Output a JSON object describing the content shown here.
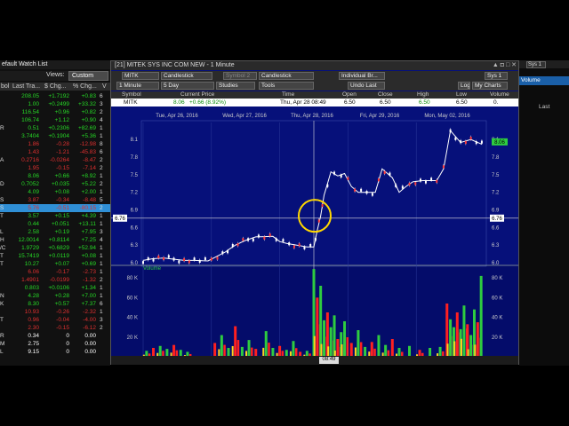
{
  "watchlist": {
    "title": "efault Watch List",
    "views_label": "Views:",
    "views_value": "Custom",
    "headers": [
      "bol",
      "Last Tra...",
      "$ Chg...",
      "% Chg...",
      "V"
    ],
    "rows": [
      {
        "sym": "",
        "last": "208.05",
        "chg": "+1.7192",
        "pct": "+0.83",
        "v": "6",
        "color": "#26d926"
      },
      {
        "sym": "",
        "last": "1.00",
        "chg": "+0.2499",
        "pct": "+33.32",
        "v": "3",
        "color": "#26d926"
      },
      {
        "sym": "",
        "last": "116.54",
        "chg": "+0.96",
        "pct": "+0.82",
        "v": "2",
        "color": "#26d926"
      },
      {
        "sym": "",
        "last": "106.74",
        "chg": "+1.12",
        "pct": "+0.90",
        "v": "4",
        "color": "#26d926"
      },
      {
        "sym": "R",
        "last": "0.51",
        "chg": "+0.2306",
        "pct": "+82.69",
        "v": "1",
        "color": "#26d926"
      },
      {
        "sym": "",
        "last": "3.7404",
        "chg": "+0.1904",
        "pct": "+5.36",
        "v": "1",
        "color": "#26d926"
      },
      {
        "sym": "",
        "last": "1.86",
        "chg": "-0.28",
        "pct": "-12.98",
        "v": "8",
        "color": "#e03030"
      },
      {
        "sym": "",
        "last": "1.43",
        "chg": "-1.21",
        "pct": "-45.83",
        "v": "6",
        "color": "#e03030"
      },
      {
        "sym": "A",
        "last": "0.2716",
        "chg": "-0.0264",
        "pct": "-8.47",
        "v": "2",
        "color": "#e03030"
      },
      {
        "sym": "",
        "last": "1.95",
        "chg": "-0.15",
        "pct": "-7.14",
        "v": "2",
        "color": "#e03030"
      },
      {
        "sym": "",
        "last": "8.06",
        "chg": "+0.66",
        "pct": "+8.92",
        "v": "1",
        "color": "#26d926"
      },
      {
        "sym": "D",
        "last": "0.7052",
        "chg": "+0.035",
        "pct": "+5.22",
        "v": "2",
        "color": "#26d926"
      },
      {
        "sym": "",
        "last": "4.09",
        "chg": "+0.08",
        "pct": "+2.00",
        "v": "1",
        "color": "#26d926"
      },
      {
        "sym": "S",
        "last": "3.87",
        "chg": "-0.34",
        "pct": "-8.48",
        "v": "5",
        "color": "#e03030"
      },
      {
        "sym": "S",
        "last": "5.76",
        "chg": "-0.51",
        "pct": "-80.15",
        "v": "2",
        "color": "#e03030",
        "selected": true
      },
      {
        "sym": "T",
        "last": "3.57",
        "chg": "+0.15",
        "pct": "+4.39",
        "v": "1",
        "color": "#26d926"
      },
      {
        "sym": "",
        "last": "0.44",
        "chg": "+0.051",
        "pct": "+13.11",
        "v": "1",
        "color": "#26d926"
      },
      {
        "sym": "L",
        "last": "2.58",
        "chg": "+0.19",
        "pct": "+7.95",
        "v": "3",
        "color": "#26d926"
      },
      {
        "sym": "H",
        "last": "12.0014",
        "chg": "+0.8114",
        "pct": "+7.25",
        "v": "4",
        "color": "#26d926"
      },
      {
        "sym": "/C",
        "last": "1.9729",
        "chg": "+0.6829",
        "pct": "+52.94",
        "v": "1",
        "color": "#26d926"
      },
      {
        "sym": "T",
        "last": "15.7419",
        "chg": "+0.0119",
        "pct": "+0.08",
        "v": "1",
        "color": "#26d926"
      },
      {
        "sym": "T",
        "last": "10.27",
        "chg": "+0.07",
        "pct": "+0.69",
        "v": "1",
        "color": "#26d926"
      },
      {
        "sym": "",
        "last": "6.06",
        "chg": "-0.17",
        "pct": "-2.73",
        "v": "1",
        "color": "#e03030"
      },
      {
        "sym": "",
        "last": "1.4901",
        "chg": "-0.0199",
        "pct": "-1.32",
        "v": "2",
        "color": "#e03030"
      },
      {
        "sym": "",
        "last": "0.803",
        "chg": "+0.0106",
        "pct": "+1.34",
        "v": "1",
        "color": "#26d926"
      },
      {
        "sym": "N",
        "last": "4.28",
        "chg": "+0.28",
        "pct": "+7.00",
        "v": "1",
        "color": "#26d926"
      },
      {
        "sym": "K",
        "last": "8.30",
        "chg": "+0.57",
        "pct": "+7.37",
        "v": "6",
        "color": "#26d926"
      },
      {
        "sym": "",
        "last": "10.93",
        "chg": "-0.26",
        "pct": "-2.32",
        "v": "1",
        "color": "#e03030"
      },
      {
        "sym": "T",
        "last": "0.96",
        "chg": "-0.04",
        "pct": "-4.00",
        "v": "3",
        "color": "#e03030"
      },
      {
        "sym": "",
        "last": "2.30",
        "chg": "-0.15",
        "pct": "-6.12",
        "v": "2",
        "color": "#e03030"
      },
      {
        "sym": "R",
        "last": "0.34",
        "chg": "0",
        "pct": "0.00",
        "v": "",
        "color": "#ffffff"
      },
      {
        "sym": "M",
        "last": "2.75",
        "chg": "0",
        "pct": "0.00",
        "v": "",
        "color": "#ffffff"
      },
      {
        "sym": "L",
        "last": "9.15",
        "chg": "0",
        "pct": "0.00",
        "v": "",
        "color": "#ffffff"
      }
    ]
  },
  "chart": {
    "window_title": "[21] MITEK SYS INC COM NEW - 1 Minute",
    "window_controls": "▲ ◘ □ ✕",
    "toolbar1": {
      "symbol": "MITK",
      "chart_type": "Candlestick",
      "symbol2": "Symbol 2",
      "chart_type2": "Candlestick",
      "broker": "Individual Br...",
      "sys": "Sys 1"
    },
    "toolbar2": {
      "interval": "1 Minute",
      "range": "5 Day",
      "studies": "Studies",
      "tools": "Tools",
      "undo": "Undo Last",
      "log": "Log",
      "my_charts": "My Charts"
    },
    "quote_headers": [
      "Symbol",
      "Current Price",
      "Time",
      "Open",
      "Close",
      "High",
      "Low",
      "Volume"
    ],
    "quote": {
      "symbol": "MITK",
      "price": "8.06",
      "change": "+0.66 (8.92%)",
      "time": "Thu, Apr 28  08:49",
      "open": "6.50",
      "close": "6.50",
      "high": "6.50",
      "low": "6.50",
      "volume": "0."
    },
    "scrub_time": "08:49",
    "crosshair_price_label": "6.76",
    "last_price_label": "8.06",
    "volume_label": "Volume",
    "colors": {
      "background": "#06107a",
      "up": "#ff3b3b",
      "down": "#ffffff",
      "vol_up": "#2ecc40",
      "vol_down": "#ff2020",
      "line": "#ffffff",
      "highlight": "#ffd700"
    }
  },
  "chart_data": {
    "type": "candlestick",
    "title": "MITEK SYS INC COM NEW - 1 Minute",
    "days": [
      "Tue, Apr 26, 2016",
      "Wed, Apr 27, 2016",
      "Thu, Apr 28, 2016",
      "Fri, Apr 29, 2016",
      "Mon, May 02, 2016"
    ],
    "ylim": [
      6.0,
      8.3
    ],
    "y_ticks": [
      6.0,
      6.3,
      6.6,
      6.9,
      7.2,
      7.5,
      7.8,
      8.1
    ],
    "volume_ticks": [
      "80 K",
      "60 K",
      "40 K",
      "20 K"
    ],
    "volume_ylim": [
      0,
      90000
    ],
    "price_path": [
      [
        0.0,
        6.04
      ],
      [
        0.03,
        6.07
      ],
      [
        0.06,
        6.08
      ],
      [
        0.09,
        6.06
      ],
      [
        0.12,
        6.04
      ],
      [
        0.15,
        6.04
      ],
      [
        0.19,
        6.03
      ],
      [
        0.21,
        6.09
      ],
      [
        0.24,
        6.18
      ],
      [
        0.27,
        6.3
      ],
      [
        0.3,
        6.38
      ],
      [
        0.33,
        6.44
      ],
      [
        0.38,
        6.45
      ],
      [
        0.4,
        6.36
      ],
      [
        0.42,
        6.33
      ],
      [
        0.45,
        6.3
      ],
      [
        0.48,
        6.27
      ],
      [
        0.5,
        6.27
      ],
      [
        0.51,
        6.55
      ],
      [
        0.52,
        6.8
      ],
      [
        0.53,
        7.15
      ],
      [
        0.55,
        7.55
      ],
      [
        0.57,
        7.48
      ],
      [
        0.59,
        7.52
      ],
      [
        0.61,
        7.3
      ],
      [
        0.63,
        7.2
      ],
      [
        0.68,
        7.2
      ],
      [
        0.7,
        7.6
      ],
      [
        0.73,
        7.45
      ],
      [
        0.75,
        7.2
      ],
      [
        0.77,
        7.3
      ],
      [
        0.79,
        7.38
      ],
      [
        0.82,
        7.4
      ],
      [
        0.86,
        7.4
      ],
      [
        0.88,
        7.6
      ],
      [
        0.9,
        8.25
      ],
      [
        0.93,
        8.05
      ],
      [
        0.96,
        8.1
      ],
      [
        1.0,
        8.0
      ]
    ],
    "volume_bars": [
      [
        0.01,
        6000
      ],
      [
        0.03,
        9000
      ],
      [
        0.05,
        11000
      ],
      [
        0.07,
        8000
      ],
      [
        0.09,
        12000
      ],
      [
        0.11,
        7000
      ],
      [
        0.13,
        5000
      ],
      [
        0.21,
        14000
      ],
      [
        0.23,
        22000
      ],
      [
        0.25,
        9000
      ],
      [
        0.27,
        31000
      ],
      [
        0.29,
        10000
      ],
      [
        0.31,
        17000
      ],
      [
        0.33,
        8000
      ],
      [
        0.36,
        26000
      ],
      [
        0.38,
        9000
      ],
      [
        0.4,
        11000
      ],
      [
        0.42,
        7000
      ],
      [
        0.44,
        16000
      ],
      [
        0.46,
        5000
      ],
      [
        0.48,
        6000
      ],
      [
        0.5,
        89000
      ],
      [
        0.51,
        60000
      ],
      [
        0.52,
        72000
      ],
      [
        0.53,
        37000
      ],
      [
        0.54,
        45000
      ],
      [
        0.55,
        30000
      ],
      [
        0.56,
        42000
      ],
      [
        0.57,
        18000
      ],
      [
        0.58,
        25000
      ],
      [
        0.59,
        36000
      ],
      [
        0.61,
        14000
      ],
      [
        0.63,
        27000
      ],
      [
        0.65,
        10000
      ],
      [
        0.67,
        15000
      ],
      [
        0.69,
        22000
      ],
      [
        0.71,
        12000
      ],
      [
        0.73,
        18000
      ],
      [
        0.75,
        9000
      ],
      [
        0.78,
        11000
      ],
      [
        0.81,
        7000
      ],
      [
        0.84,
        9000
      ],
      [
        0.87,
        10000
      ],
      [
        0.89,
        54000
      ],
      [
        0.9,
        38000
      ],
      [
        0.91,
        30000
      ],
      [
        0.92,
        45000
      ],
      [
        0.93,
        28000
      ],
      [
        0.94,
        52000
      ],
      [
        0.95,
        33000
      ],
      [
        0.96,
        22000
      ],
      [
        0.97,
        48000
      ],
      [
        0.98,
        35000
      ],
      [
        0.99,
        82000
      ]
    ]
  },
  "right_panel": {
    "sys": "Sys 1",
    "volume": "Volume",
    "last": "Last"
  }
}
